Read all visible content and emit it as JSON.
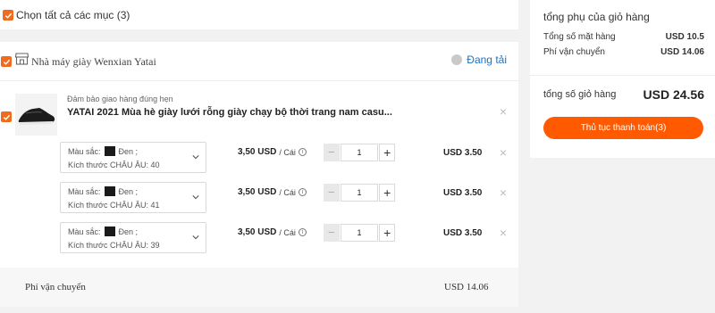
{
  "select_all": {
    "label": "Chọn tất cả các mục (3)",
    "checked": true
  },
  "shop": {
    "name": "Nhà máy giày Wenxian Yatai",
    "follow_label": "Đang tải",
    "store_icon": "store-icon",
    "product": {
      "guarantee": "Đảm bảo giao hàng đúng hẹn",
      "title": "YATAI 2021 Mùa hè giày lưới rỗng giày chạy bộ thời trang nam casu...",
      "items": [
        {
          "color_label": "Màu sắc:",
          "color_value": "Đen ;",
          "size_text": "Kích thước CHÂU ÂU: 40",
          "price": "3,50 USD",
          "unit": "/ Cái",
          "qty": "1",
          "total": "USD 3.50"
        },
        {
          "color_label": "Màu sắc:",
          "color_value": "Đen ;",
          "size_text": "Kích thước CHÂU ÂU: 41",
          "price": "3,50 USD",
          "unit": "/ Cái",
          "qty": "1",
          "total": "USD 3.50"
        },
        {
          "color_label": "Màu sắc:",
          "color_value": "Đen ;",
          "size_text": "Kích thước CHÂU ÂU: 39",
          "price": "3,50 USD",
          "unit": "/ Cái",
          "qty": "1",
          "total": "USD 3.50"
        }
      ]
    },
    "shipping_label": "Phí vận chuyển",
    "shipping_value": "USD 14.06"
  },
  "summary": {
    "title": "tổng phụ của giỏ hàng",
    "items_label": "Tổng số mặt hàng",
    "items_value": "USD 10.5",
    "shipping_label": "Phí vận chuyển",
    "shipping_value": "USD 14.06",
    "total_label": "tổng số giỏ hàng",
    "total_value": "USD 24.56",
    "checkout_label": "Thủ tục thanh toán(3)"
  },
  "colors": {
    "accent": "#ff5a00",
    "checkbox": "#f26b1d",
    "link": "#1a73c9"
  }
}
